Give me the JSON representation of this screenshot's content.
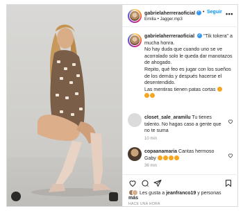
{
  "post": {
    "username": "gabrielaherreraoficial",
    "follow_label": "Seguir",
    "separator": "•",
    "audio": "Emilia • Jagger.mp3",
    "more_label": "•••"
  },
  "caption": {
    "username": "gabrielaherreraoficial",
    "lines": [
      "\"Tik tokera\" a mucha honra.",
      "No hay duda que cuando uno se ve acorralado solo le queda dar manotazos de ahogado.",
      "Repito, qué feo es jugar con los sueños de los demás y después hacerse el desentendido.",
      "Las mentiras tienen patas cortas"
    ]
  },
  "comments": [
    {
      "username": "closet_sale_aramilu",
      "text": "Tu tienes talento. No hagas caso a gente que no te suma",
      "time": "10 min"
    },
    {
      "username": "copaanamaria",
      "text": "Cantas hermoso Gaby",
      "time": "36 min"
    }
  ],
  "likes": {
    "prefix": "Les gusta a",
    "user": "jeanfranco19",
    "suffix": "y personas",
    "more": "más"
  },
  "date": "HACE UNA HORA",
  "icons": {
    "heart": "heart-icon",
    "comment": "comment-icon",
    "share": "share-icon",
    "save": "bookmark-icon",
    "verified": "verified-badge-icon",
    "camera": "camera-icon",
    "reel": "reel-icon"
  },
  "colors": {
    "follow": "#0095f6",
    "verified": "#3897f0",
    "muted": "#8e8e8e"
  }
}
